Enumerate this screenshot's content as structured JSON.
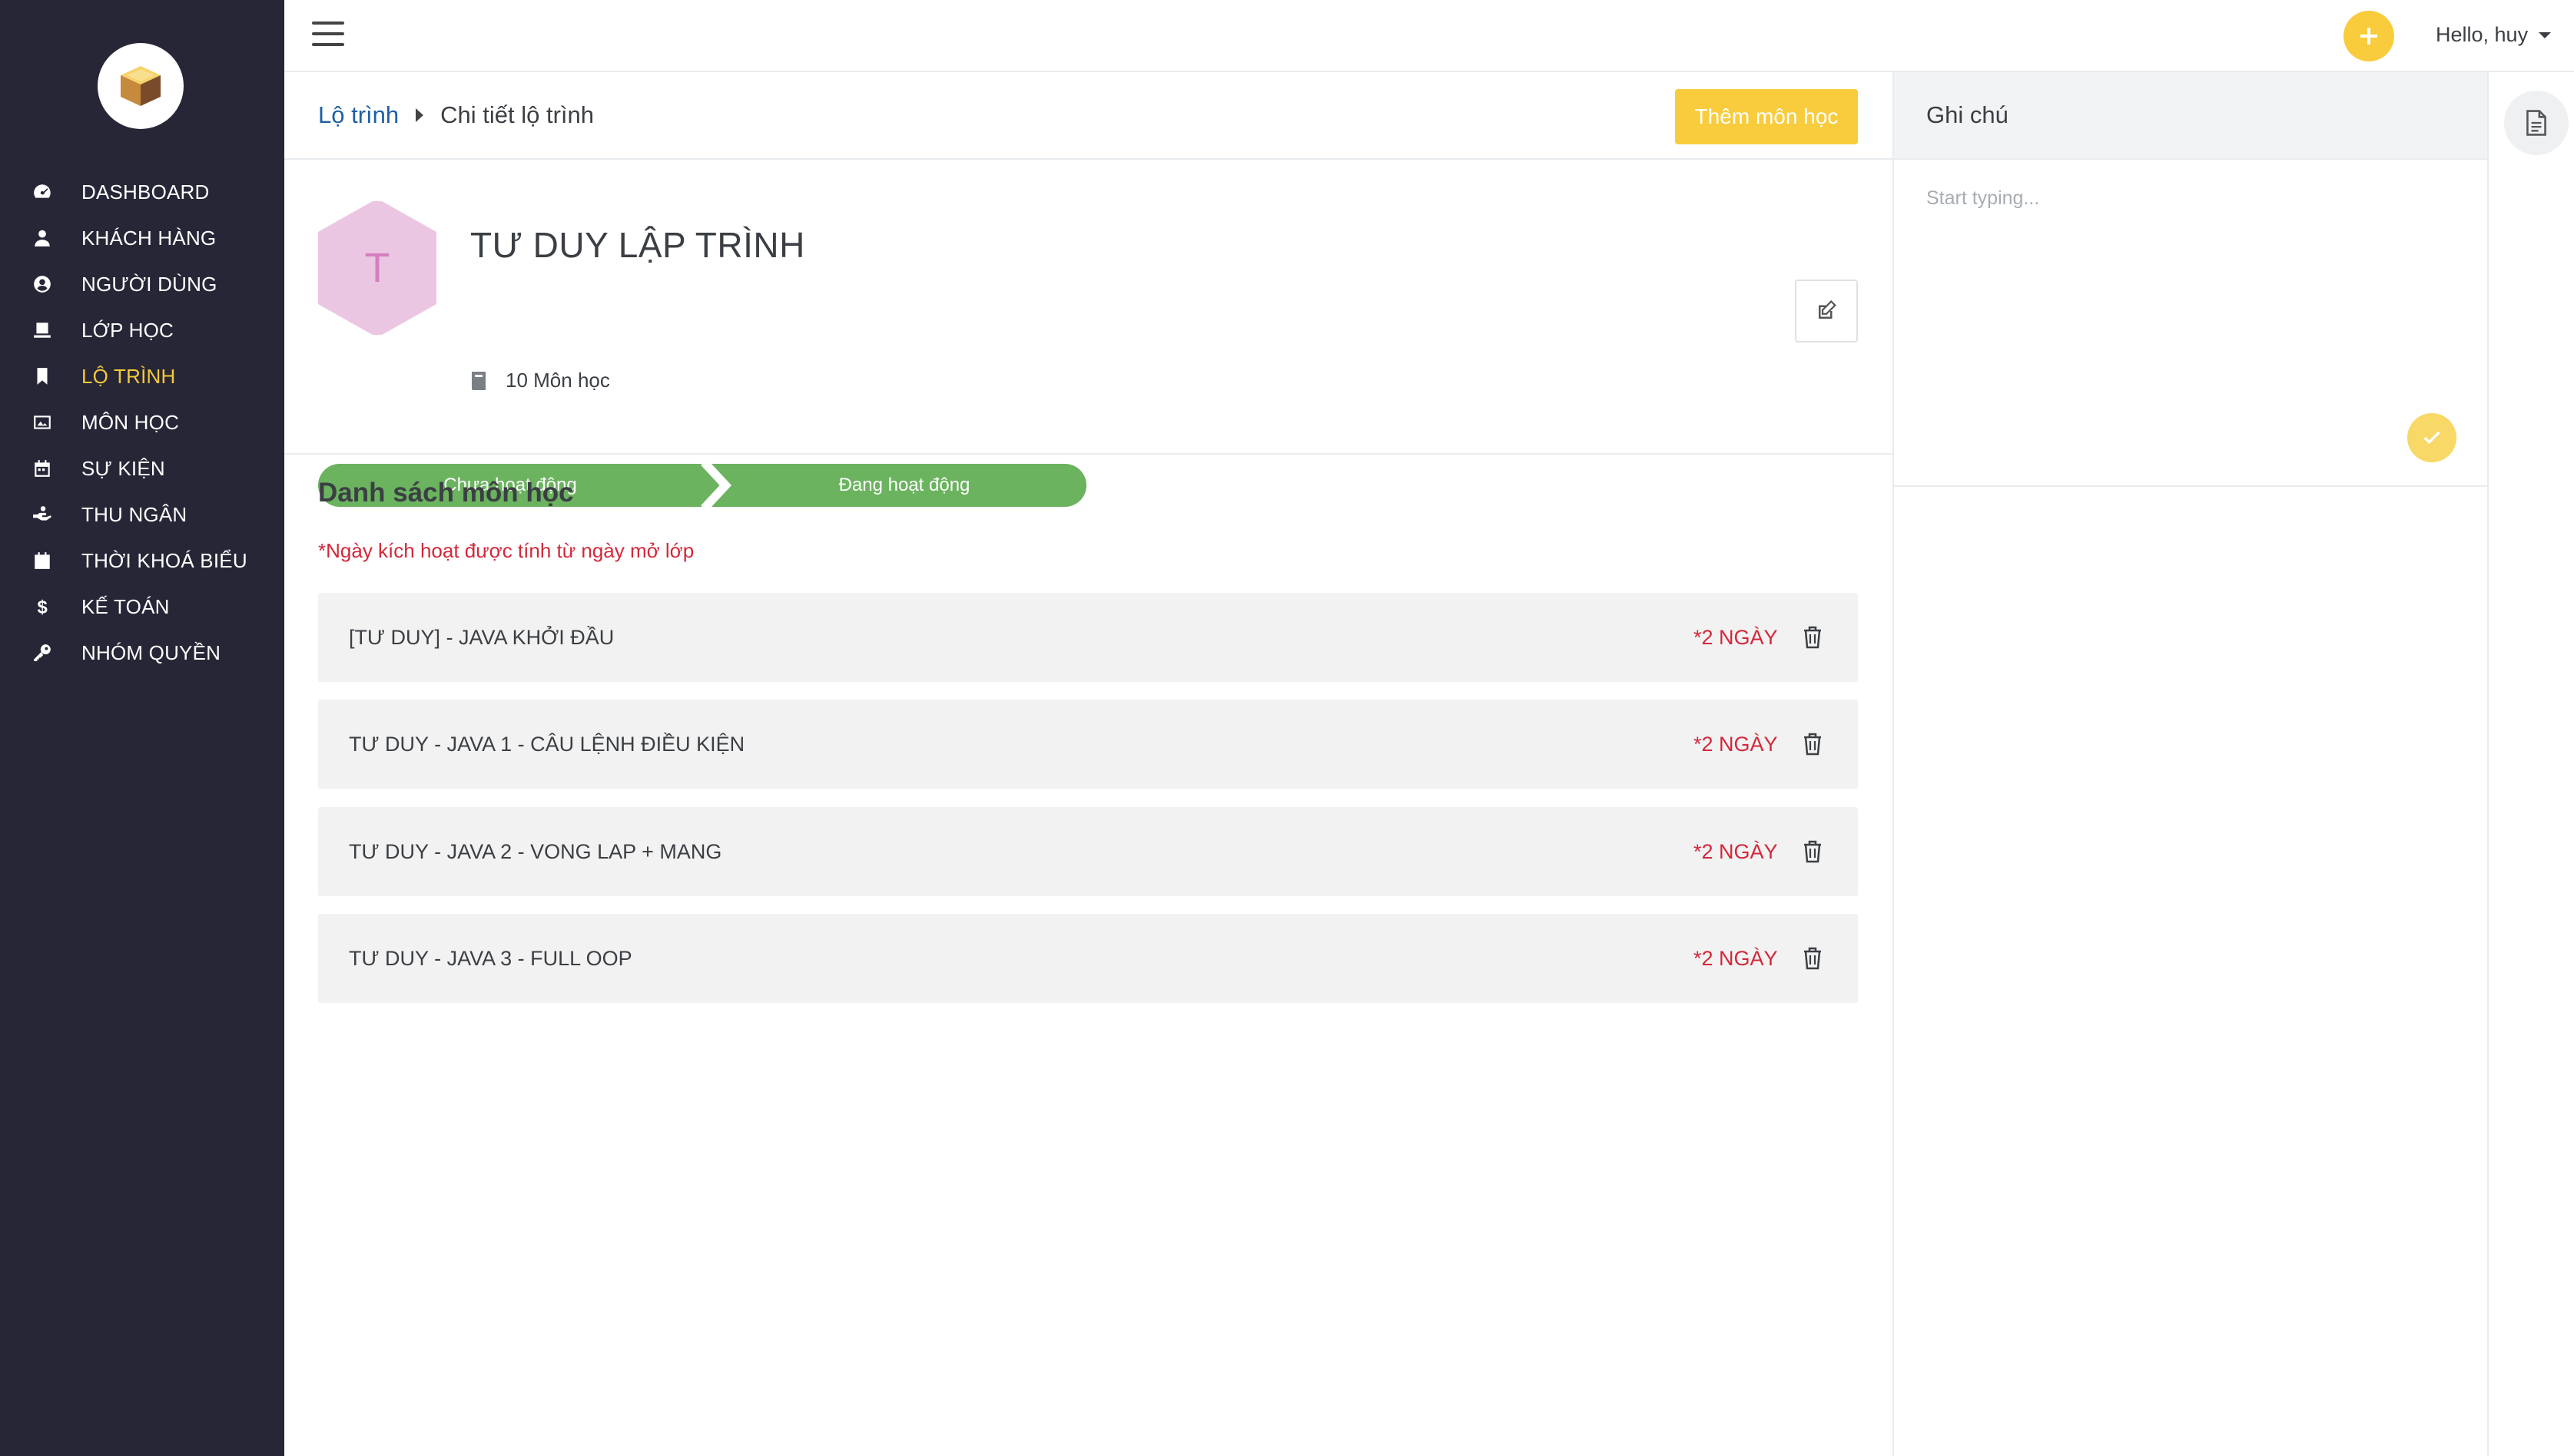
{
  "sidebar": {
    "logo": "box-logo",
    "items": [
      {
        "label": "DASHBOARD",
        "icon": "dashboard-gauge-icon"
      },
      {
        "label": "KHÁCH HÀNG",
        "icon": "customer-icon"
      },
      {
        "label": "NGƯỜI DÙNG",
        "icon": "user-circle-icon"
      },
      {
        "label": "LỚP HỌC",
        "icon": "classroom-icon"
      },
      {
        "label": "LỘ TRÌNH",
        "icon": "bookmark-icon",
        "active": true
      },
      {
        "label": "MÔN HỌC",
        "icon": "image-icon"
      },
      {
        "label": "SỰ KIỆN",
        "icon": "calendar-icon"
      },
      {
        "label": "THU NGÂN",
        "icon": "cashier-hand-icon"
      },
      {
        "label": "THỜI KHOÁ BIỂU",
        "icon": "calendar-solid-icon"
      },
      {
        "label": "KẾ TOÁN",
        "icon": "dollar-icon"
      },
      {
        "label": "NHÓM QUYỀN",
        "icon": "key-icon"
      }
    ]
  },
  "topbar": {
    "greeting": "Hello, huy"
  },
  "breadcrumb": {
    "parent": "Lộ trình",
    "current": "Chi tiết lộ trình"
  },
  "actions": {
    "add_course": "Thêm môn học"
  },
  "roadmap": {
    "avatar_letter": "T",
    "title": "TƯ DUY LẬP TRÌNH",
    "course_count": "10 Môn học",
    "stages": [
      "Chưa hoạt động",
      "Đang hoạt động"
    ]
  },
  "course_list": {
    "heading": "Danh sách môn học",
    "note": "*Ngày kích hoạt được tính từ ngày mở lớp",
    "courses": [
      {
        "name": "[TƯ DUY] - JAVA KHỞI ĐẦU",
        "days": "*2 NGÀY"
      },
      {
        "name": "TƯ DUY - JAVA 1 - CÂU LỆNH ĐIỀU KIỆN",
        "days": "*2 NGÀY"
      },
      {
        "name": "TƯ DUY - JAVA 2 - VONG LAP + MANG",
        "days": "*2 NGÀY"
      },
      {
        "name": "TƯ DUY - JAVA 3 - FULL OOP",
        "days": "*2 NGÀY"
      }
    ]
  },
  "notes": {
    "title": "Ghi chú",
    "placeholder": "Start typing..."
  },
  "colors": {
    "sidebar_bg": "#262637",
    "accent_yellow": "#f8cc3c",
    "link_blue": "#1f5fa5",
    "stage_green": "#6bb35f",
    "danger_red": "#d3283a",
    "avatar_pink": "#ebc6e3"
  }
}
